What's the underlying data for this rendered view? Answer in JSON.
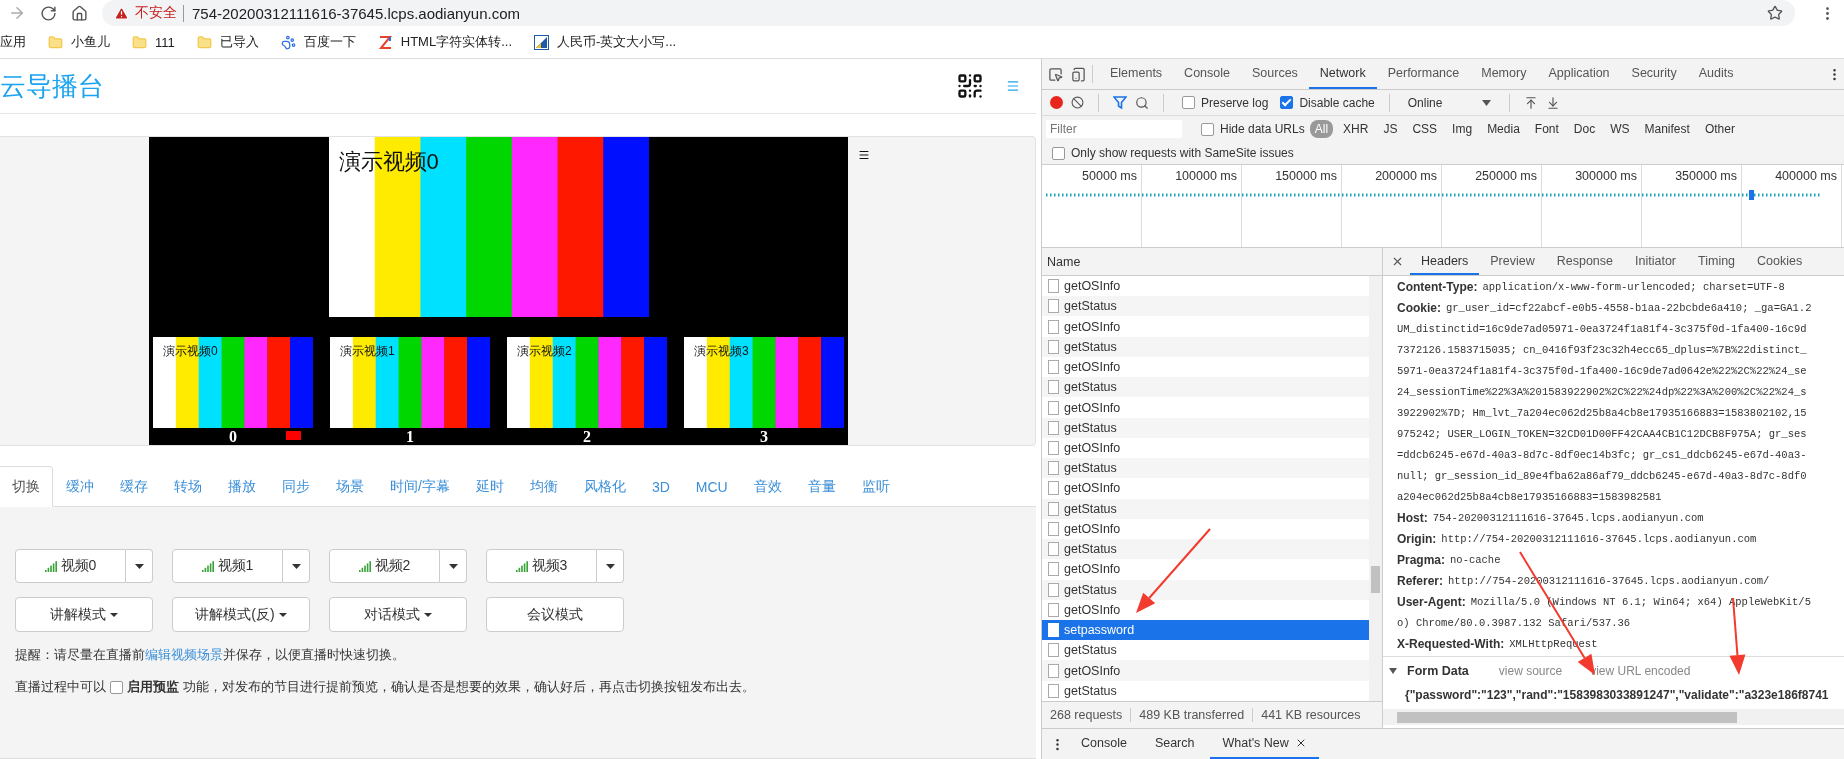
{
  "browser": {
    "security_label": "不安全",
    "url": "754-20200312111616-37645.lcps.aodianyun.com",
    "bookmarks": [
      {
        "kind": "apps",
        "label": "应用"
      },
      {
        "kind": "folder",
        "label": "小鱼儿"
      },
      {
        "kind": "folder",
        "label": "111"
      },
      {
        "kind": "folder",
        "label": "已导入"
      },
      {
        "kind": "paw",
        "label": "百度一下"
      },
      {
        "kind": "zlogo",
        "label": "HTML字符实体转..."
      },
      {
        "kind": "tile",
        "label": "人民币-英文大小写..."
      }
    ]
  },
  "page": {
    "title": "云导播台",
    "preview": {
      "main_title": "演示视频0",
      "thumbnails": [
        {
          "title": "演示视频0",
          "number": "0",
          "on_air": true
        },
        {
          "title": "演示视频1",
          "number": "1",
          "on_air": false
        },
        {
          "title": "演示视频2",
          "number": "2",
          "on_air": false
        },
        {
          "title": "演示视频3",
          "number": "3",
          "on_air": false
        }
      ]
    },
    "tabs": [
      {
        "label": "切换",
        "selected": true
      },
      {
        "label": "缓冲",
        "selected": false
      },
      {
        "label": "缓存",
        "selected": false
      },
      {
        "label": "转场",
        "selected": false
      },
      {
        "label": "播放",
        "selected": false
      },
      {
        "label": "同步",
        "selected": false
      },
      {
        "label": "场景",
        "selected": false
      },
      {
        "label": "时间/字幕",
        "selected": false
      },
      {
        "label": "延时",
        "selected": false
      },
      {
        "label": "均衡",
        "selected": false
      },
      {
        "label": "风格化",
        "selected": false
      },
      {
        "label": "3D",
        "selected": false
      },
      {
        "label": "MCU",
        "selected": false
      },
      {
        "label": "音效",
        "selected": false
      },
      {
        "label": "音量",
        "selected": false
      },
      {
        "label": "监听",
        "selected": false
      }
    ],
    "sources": [
      {
        "label": "视频0"
      },
      {
        "label": "视频1"
      },
      {
        "label": "视频2"
      },
      {
        "label": "视频3"
      }
    ],
    "modes": [
      {
        "label": "讲解模式",
        "dropdown": true
      },
      {
        "label": "讲解模式(反)",
        "dropdown": true
      },
      {
        "label": "对话模式",
        "dropdown": true
      },
      {
        "label": "会议模式",
        "dropdown": false
      }
    ],
    "tip": {
      "before": "提醒：请尽量在直播前",
      "link": "编辑视频场景",
      "after": "并保存，以便直播时快速切换。"
    },
    "preview_note": {
      "before": "直播过程中可以",
      "checkbox_label": "启用预监",
      "checked": false,
      "after": "功能，对发布的节目进行提前预览，确认是否是想要的效果，确认好后，再点击切换按钮发布出去。"
    }
  },
  "devtools": {
    "panel_tabs": [
      {
        "label": "Elements",
        "selected": false
      },
      {
        "label": "Console",
        "selected": false
      },
      {
        "label": "Sources",
        "selected": false
      },
      {
        "label": "Network",
        "selected": true
      },
      {
        "label": "Performance",
        "selected": false
      },
      {
        "label": "Memory",
        "selected": false
      },
      {
        "label": "Application",
        "selected": false
      },
      {
        "label": "Security",
        "selected": false
      },
      {
        "label": "Audits",
        "selected": false
      }
    ],
    "recording": true,
    "preserve_log": {
      "label": "Preserve log",
      "checked": false
    },
    "disable_cache": {
      "label": "Disable cache",
      "checked": true
    },
    "throttling": "Online",
    "filter": {
      "placeholder": "Filter"
    },
    "hide_data_urls": {
      "label": "Hide data URLs",
      "checked": false
    },
    "type_filters": [
      {
        "label": "All",
        "selected": true
      },
      {
        "label": "XHR",
        "selected": false
      },
      {
        "label": "JS",
        "selected": false
      },
      {
        "label": "CSS",
        "selected": false
      },
      {
        "label": "Img",
        "selected": false
      },
      {
        "label": "Media",
        "selected": false
      },
      {
        "label": "Font",
        "selected": false
      },
      {
        "label": "Doc",
        "selected": false
      },
      {
        "label": "WS",
        "selected": false
      },
      {
        "label": "Manifest",
        "selected": false
      },
      {
        "label": "Other",
        "selected": false
      }
    ],
    "samesite_only": {
      "label": "Only show requests with SameSite issues",
      "checked": false
    },
    "timeline_ticks": [
      "50000 ms",
      "100000 ms",
      "150000 ms",
      "200000 ms",
      "250000 ms",
      "300000 ms",
      "350000 ms",
      "400000 ms"
    ],
    "name_header": "Name",
    "requests": [
      {
        "name": "getOSInfo",
        "selected": false
      },
      {
        "name": "getStatus",
        "selected": false
      },
      {
        "name": "getOSInfo",
        "selected": false
      },
      {
        "name": "getStatus",
        "selected": false
      },
      {
        "name": "getOSInfo",
        "selected": false
      },
      {
        "name": "getStatus",
        "selected": false
      },
      {
        "name": "getOSInfo",
        "selected": false
      },
      {
        "name": "getStatus",
        "selected": false
      },
      {
        "name": "getOSInfo",
        "selected": false
      },
      {
        "name": "getStatus",
        "selected": false
      },
      {
        "name": "getOSInfo",
        "selected": false
      },
      {
        "name": "getStatus",
        "selected": false
      },
      {
        "name": "getOSInfo",
        "selected": false
      },
      {
        "name": "getStatus",
        "selected": false
      },
      {
        "name": "getOSInfo",
        "selected": false
      },
      {
        "name": "getStatus",
        "selected": false
      },
      {
        "name": "getOSInfo",
        "selected": false
      },
      {
        "name": "setpassword",
        "selected": true
      },
      {
        "name": "getStatus",
        "selected": false
      },
      {
        "name": "getOSInfo",
        "selected": false
      },
      {
        "name": "getStatus",
        "selected": false
      }
    ],
    "summary": [
      "268 requests",
      "489 KB transferred",
      "441 KB resources"
    ],
    "detail_tabs": [
      {
        "label": "Headers",
        "selected": true
      },
      {
        "label": "Preview",
        "selected": false
      },
      {
        "label": "Response",
        "selected": false
      },
      {
        "label": "Initiator",
        "selected": false
      },
      {
        "label": "Timing",
        "selected": false
      },
      {
        "label": "Cookies",
        "selected": false
      }
    ],
    "headers": [
      {
        "name": "Content-Type:",
        "lines": [
          "application/x-www-form-urlencoded; charset=UTF-8"
        ]
      },
      {
        "name": "Cookie:",
        "lines": [
          "gr_user_id=cf22abcf-e0b5-4558-b1aa-22bcbde6a410; _ga=GA1.2",
          "UM_distinctid=16c9de7ad05971-0ea3724f1a81f4-3c375f0d-1fa400-16c9d",
          "7372126.1583715035; cn_0416f93f23c32h4ecc65_dplus=%7B%22distinct_",
          "5971-0ea3724f1a81f4-3c375f0d-1fa400-16c9de7ad0642e%22%2C%22%24_se",
          "24_sessionTime%22%3A%201583922902%2C%22%24dp%22%3A%200%2C%22%24_s",
          "3922902%7D; Hm_lvt_7a204ec062d25b8a4cb8e17935166883=1583802102,15",
          "975242; USER_LOGIN_TOKEN=32CD01D00FF42CAA4CB1C12DCB8F975A; gr_ses",
          "=ddcb6245-e67d-40a3-8d7c-8df0ec14b3fc; gr_cs1_ddcb6245-e67d-40a3-",
          "null; gr_session_id_89e4fba62a86af79_ddcb6245-e67d-40a3-8d7c-8df0",
          "a204ec062d25b8a4cb8e17935166883=1583982581"
        ]
      },
      {
        "name": "Host:",
        "lines": [
          "754-20200312111616-37645.lcps.aodianyun.com"
        ]
      },
      {
        "name": "Origin:",
        "lines": [
          "http://754-20200312111616-37645.lcps.aodianyun.com"
        ]
      },
      {
        "name": "Pragma:",
        "lines": [
          "no-cache"
        ]
      },
      {
        "name": "Referer:",
        "lines": [
          "http://754-20200312111616-37645.lcps.aodianyun.com/"
        ]
      },
      {
        "name": "User-Agent:",
        "lines": [
          "Mozilla/5.0 (Windows NT 6.1; Win64; x64) AppleWebKit/5",
          "o) Chrome/80.0.3987.132 Safari/537.36"
        ]
      },
      {
        "name": "X-Requested-With:",
        "lines": [
          "XMLHttpRequest"
        ]
      }
    ],
    "form_data": {
      "title": "Form Data",
      "expanded": true,
      "links": [
        "view source",
        "view URL encoded"
      ],
      "value": "{\"password\":\"123\",\"rand\":\"1583983033891247\",\"validate\":\"a323e186f8741"
    },
    "drawer_tabs": [
      {
        "label": "Console",
        "selected": false,
        "closable": false
      },
      {
        "label": "Search",
        "selected": false,
        "closable": false
      },
      {
        "label": "What's New",
        "selected": true,
        "closable": true
      }
    ]
  }
}
